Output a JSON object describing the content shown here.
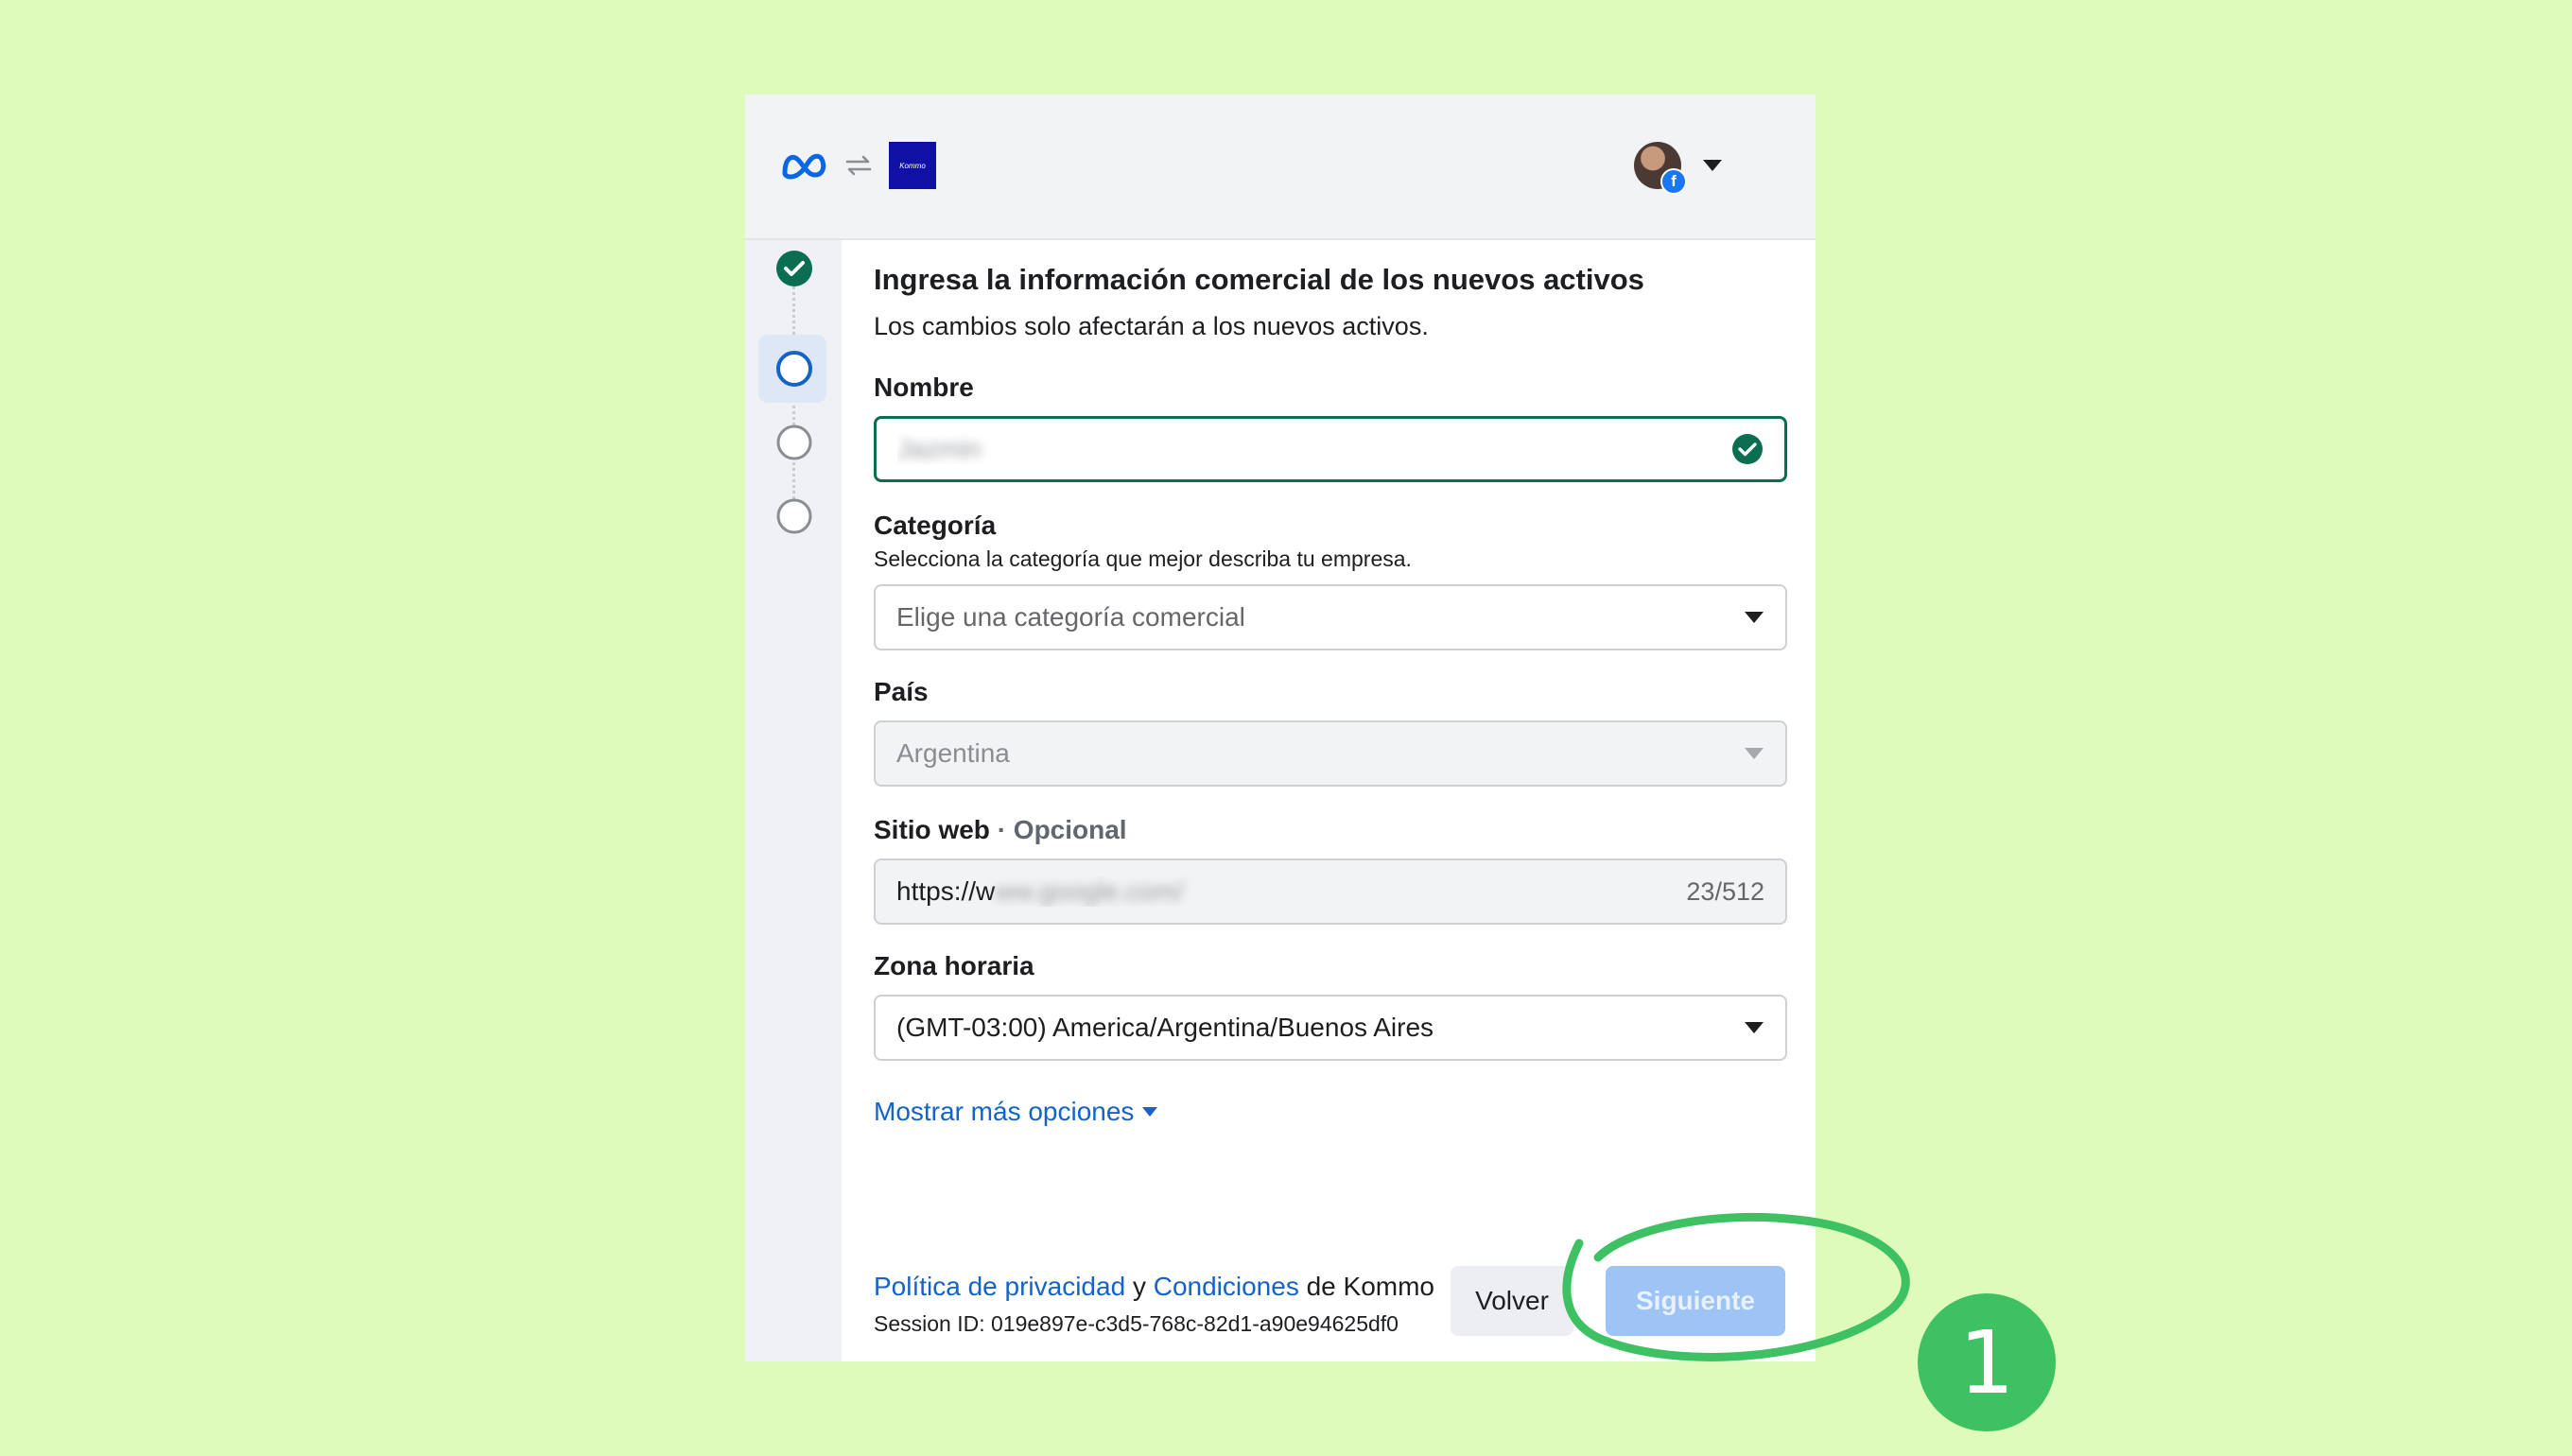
{
  "header": {
    "meta_logo": "meta-logo",
    "sync_icon": "sync-arrows-icon",
    "app_logo_text": "Kommo",
    "account_menu_icon": "caret-down-icon"
  },
  "stepper": {
    "steps": [
      {
        "state": "completed",
        "icon": "check-circle-icon"
      },
      {
        "state": "active",
        "icon": "circle-icon"
      },
      {
        "state": "pending",
        "icon": "circle-icon"
      },
      {
        "state": "pending",
        "icon": "circle-icon"
      }
    ]
  },
  "form": {
    "title": "Ingresa la información comercial de los nuevos activos",
    "subtitle": "Los cambios solo afectarán a los nuevos activos.",
    "name": {
      "label": "Nombre",
      "value": "Jazmin",
      "status_icon": "check-circle-icon"
    },
    "category": {
      "label": "Categoría",
      "helper": "Selecciona la categoría que mejor describa tu empresa.",
      "placeholder": "Elige una categoría comercial"
    },
    "country": {
      "label": "País",
      "value": "Argentina",
      "disabled": true
    },
    "website": {
      "label": "Sitio web",
      "optional": "· Opcional",
      "value_prefix": "https://w",
      "value_rest": "ww.google.com/",
      "counter": "23/512"
    },
    "timezone": {
      "label": "Zona horaria",
      "value": "(GMT-03:00) America/Argentina/Buenos Aires"
    },
    "more_options": "Mostrar más opciones"
  },
  "footer": {
    "privacy_link": "Política de privacidad",
    "and": "y",
    "terms_link": "Condiciones",
    "of_company": "de Kommo",
    "session": "Session ID: 019e897e-c3d5-768c-82d1-a90e94625df0",
    "back_button": "Volver",
    "next_button": "Siguiente"
  },
  "annotation": {
    "step_number": "1"
  },
  "colors": {
    "background": "#dffbb9",
    "link": "#1463c6",
    "valid_green": "#0b6e50",
    "primary_disabled": "#9ec4f5",
    "annotation_green": "#3ec163"
  }
}
